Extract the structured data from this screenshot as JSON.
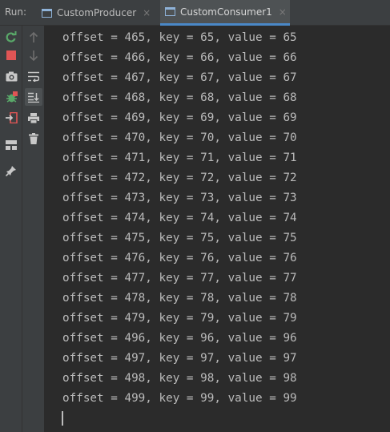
{
  "run_bar": {
    "label": "Run:",
    "tabs": [
      {
        "label": "CustomProducer",
        "close": "×",
        "active": false
      },
      {
        "label": "CustomConsumer1",
        "close": "×",
        "active": true
      }
    ]
  },
  "toolbar": {
    "left": [
      "rerun-icon",
      "stop-icon",
      "camera-icon",
      "debug-icon",
      "exit-icon",
      "layout-icon",
      "pin-icon"
    ],
    "right": [
      "arrow-up-icon",
      "arrow-down-icon",
      "soft-wrap-icon",
      "scroll-to-end-icon",
      "print-icon",
      "trash-icon"
    ]
  },
  "console": {
    "lines": [
      "offset = 465, key = 65, value = 65",
      "offset = 466, key = 66, value = 66",
      "offset = 467, key = 67, value = 67",
      "offset = 468, key = 68, value = 68",
      "offset = 469, key = 69, value = 69",
      "offset = 470, key = 70, value = 70",
      "offset = 471, key = 71, value = 71",
      "offset = 472, key = 72, value = 72",
      "offset = 473, key = 73, value = 73",
      "offset = 474, key = 74, value = 74",
      "offset = 475, key = 75, value = 75",
      "offset = 476, key = 76, value = 76",
      "offset = 477, key = 77, value = 77",
      "offset = 478, key = 78, value = 78",
      "offset = 479, key = 79, value = 79",
      "offset = 496, key = 96, value = 96",
      "offset = 497, key = 97, value = 97",
      "offset = 498, key = 98, value = 98",
      "offset = 499, key = 99, value = 99"
    ]
  },
  "colors": {
    "background": "#2b2b2b",
    "toolbar": "#3c3f41",
    "text": "#bababa",
    "accent": "#4a88c7",
    "rerun": "#59a869",
    "stop": "#e05555"
  }
}
